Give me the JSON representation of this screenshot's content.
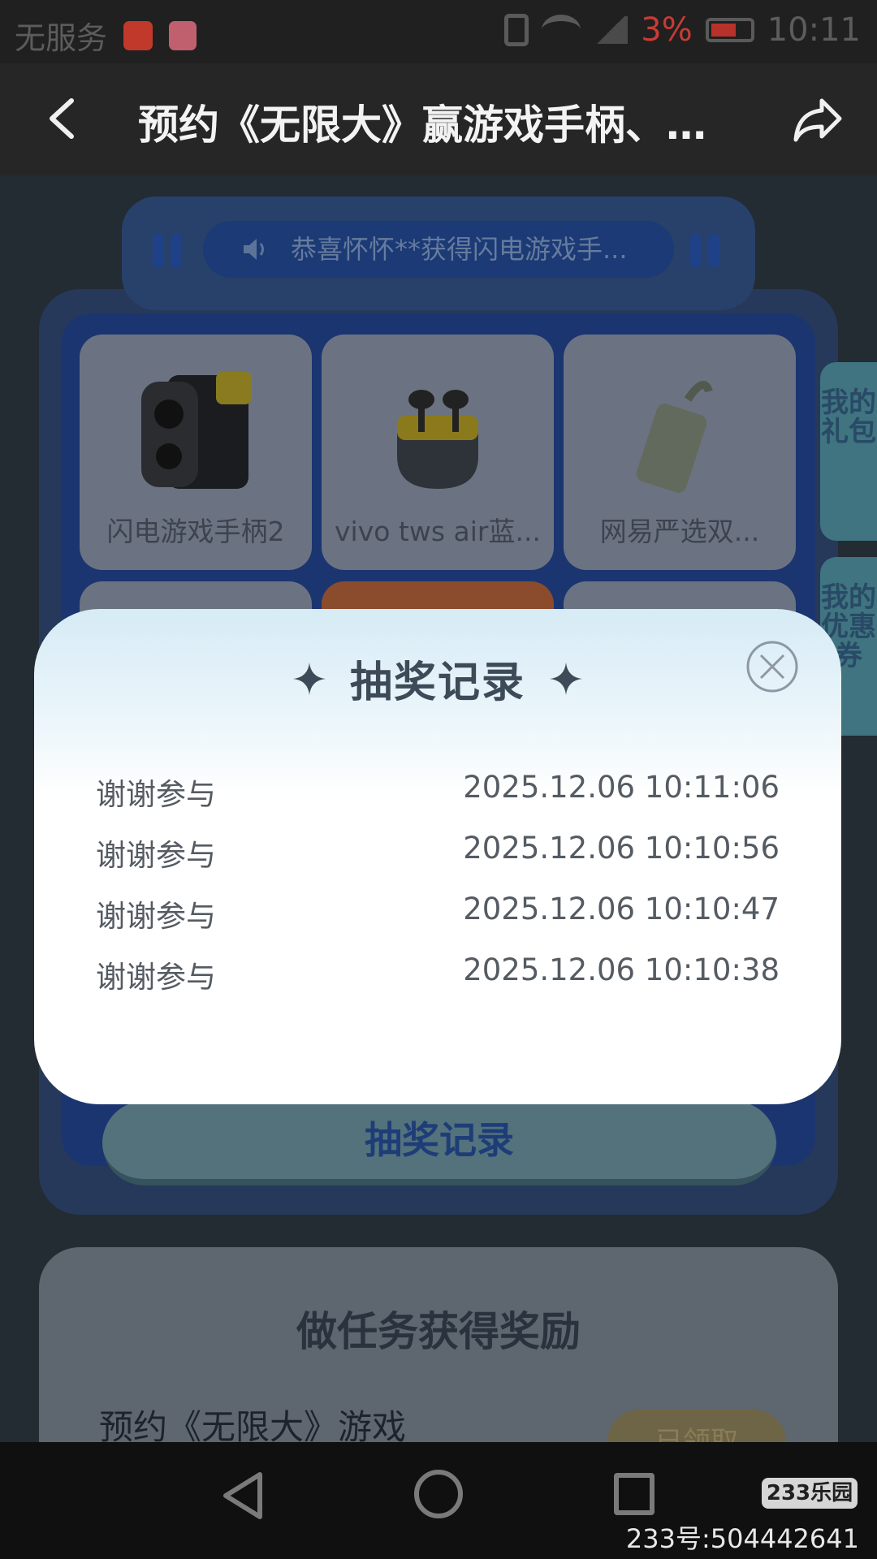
{
  "status_bar": {
    "carrier": "无服务",
    "battery_percent": "3%",
    "time": "10:11",
    "battery_color": "#c93b35"
  },
  "app_bar": {
    "title": "预约《无限大》赢游戏手柄、蓝牙...",
    "back_icon": "chevron-left-icon",
    "share_icon": "share-icon"
  },
  "ticker": {
    "text": "恭喜怀怀**获得闪电游戏手..."
  },
  "prizes": [
    {
      "label": "闪电游戏手柄2"
    },
    {
      "label": "vivo tws air蓝..."
    },
    {
      "label": "网易严选双..."
    }
  ],
  "side_tabs": {
    "gift": "我的礼包",
    "coupon": "我的优惠券"
  },
  "draw_record_button": "抽奖记录",
  "task_card": {
    "title": "做任务获得奖励",
    "item": "预约《无限大》游戏",
    "button": "已领取"
  },
  "modal": {
    "title": "抽奖记录",
    "records": [
      {
        "name": "谢谢参与",
        "time": "2025.12.06 10:11:06"
      },
      {
        "name": "谢谢参与",
        "time": "2025.12.06 10:10:56"
      },
      {
        "name": "谢谢参与",
        "time": "2025.12.06 10:10:47"
      },
      {
        "name": "谢谢参与",
        "time": "2025.12.06 10:10:38"
      }
    ]
  },
  "watermark": {
    "logo": "233乐园",
    "id": "233号:504442641"
  }
}
